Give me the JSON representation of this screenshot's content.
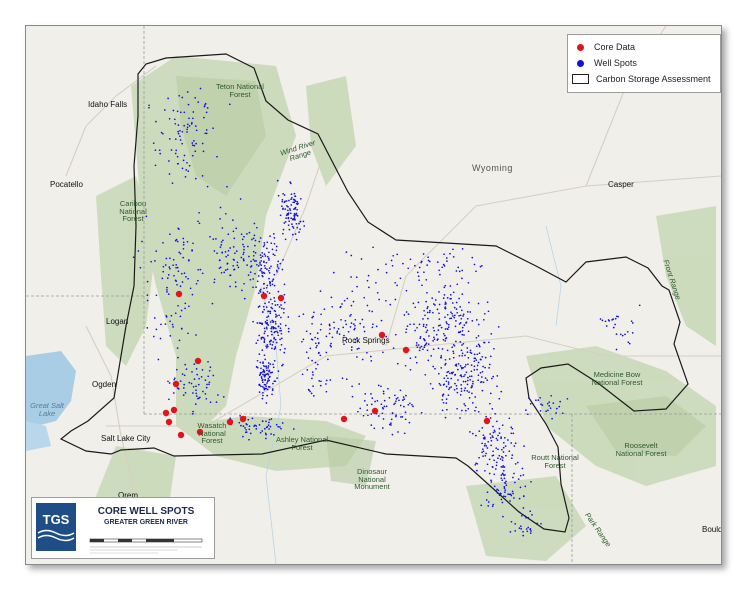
{
  "places": {
    "idaho_falls": "Idaho Falls",
    "pocatello": "Pocatello",
    "logan": "Logan",
    "ogden": "Ogden",
    "salt_lake_city": "Salt Lake City",
    "orem": "Orem",
    "wyoming": "Wyoming",
    "casper": "Casper",
    "rock_springs": "Rock Springs",
    "teton": "Teton National Forest",
    "caribou": "Caribou National Forest",
    "wind_river": "Wind River Range",
    "ashley": "Ashley National Forest",
    "wasatch": "Wasatch National Forest",
    "dinosaur": "Dinosaur National Monument",
    "medicine_bow": "Medicine Bow National Forest",
    "routt": "Routt National Forest",
    "roosevelt": "Roosevelt National Forest",
    "front_range": "Front Range",
    "park_range": "Park Range",
    "great_salt_lake": "Great Salt Lake",
    "boulder": "Bould"
  },
  "legend": {
    "core_data": "Core Data",
    "well_spots": "Well Spots",
    "carbon_storage": "Carbon Storage Assessment"
  },
  "colors": {
    "core_data": "#e0151b",
    "well_spots": "#1010e6",
    "assessment_outline": "#1a1a1a"
  },
  "title_block": {
    "logo": "TGS",
    "title": "CORE WELL SPOTS",
    "subtitle": "GREATER GREEN RIVER"
  }
}
